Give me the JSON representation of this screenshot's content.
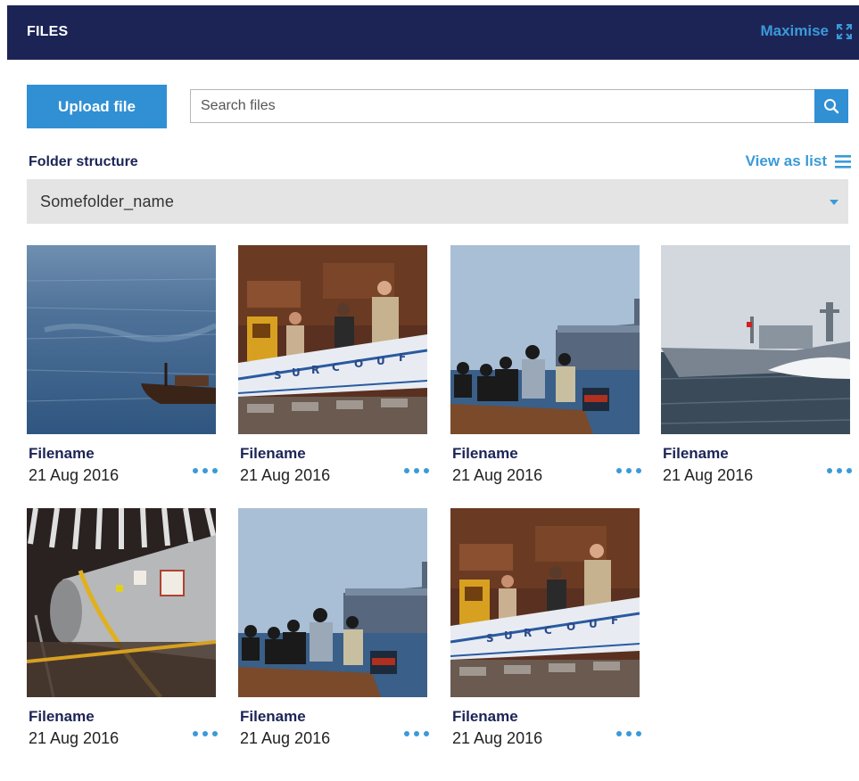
{
  "header": {
    "title": "FILES",
    "maximise_label": "Maximise"
  },
  "toolbar": {
    "upload_label": "Upload file",
    "search_placeholder": "Search files",
    "search_value": ""
  },
  "folder": {
    "label": "Folder structure",
    "view_as_list": "View as list",
    "selected": "Somefolder_name"
  },
  "files": [
    {
      "name": "Filename",
      "date": "21 Aug 2016",
      "thumb": "dhow-at-sea"
    },
    {
      "name": "Filename",
      "date": "21 Aug 2016",
      "thumb": "soldiers-surcouf"
    },
    {
      "name": "Filename",
      "date": "21 Aug 2016",
      "thumb": "skiff-passengers"
    },
    {
      "name": "Filename",
      "date": "21 Aug 2016",
      "thumb": "frigate-wake"
    },
    {
      "name": "Filename",
      "date": "21 Aug 2016",
      "thumb": "aircraft-engine-hangar"
    },
    {
      "name": "Filename",
      "date": "21 Aug 2016",
      "thumb": "skiff-passengers"
    },
    {
      "name": "Filename",
      "date": "21 Aug 2016",
      "thumb": "soldiers-surcouf"
    }
  ],
  "colors": {
    "header_bg": "#1c2456",
    "accent": "#3190d4",
    "link": "#3a9ad9",
    "select_bg": "#e4e4e4"
  }
}
